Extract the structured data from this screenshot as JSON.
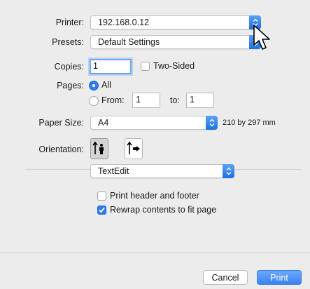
{
  "printer": {
    "label": "Printer:",
    "value": "192.168.0.12"
  },
  "presets": {
    "label": "Presets:",
    "value": "Default Settings"
  },
  "copies": {
    "label": "Copies:",
    "value": "1",
    "two_sided_label": "Two-Sided"
  },
  "pages": {
    "label": "Pages:",
    "all_label": "All",
    "from_label": "From:",
    "from_value": "1",
    "to_label": "to:",
    "to_value": "1"
  },
  "paper_size": {
    "label": "Paper Size:",
    "value": "A4",
    "dimensions": "210 by 297 mm"
  },
  "orientation": {
    "label": "Orientation:",
    "options": [
      "portrait-icon",
      "landscape-icon"
    ],
    "selected": "portrait"
  },
  "app_section": {
    "value": "TextEdit"
  },
  "options": {
    "print_header_footer": {
      "label": "Print header and footer",
      "checked": false
    },
    "rewrap_contents": {
      "label": "Rewrap contents to fit page",
      "checked": true
    }
  },
  "buttons": {
    "cancel": "Cancel",
    "print": "Print"
  },
  "colors": {
    "accent": "#2d7cf0",
    "background": "#ececec"
  }
}
